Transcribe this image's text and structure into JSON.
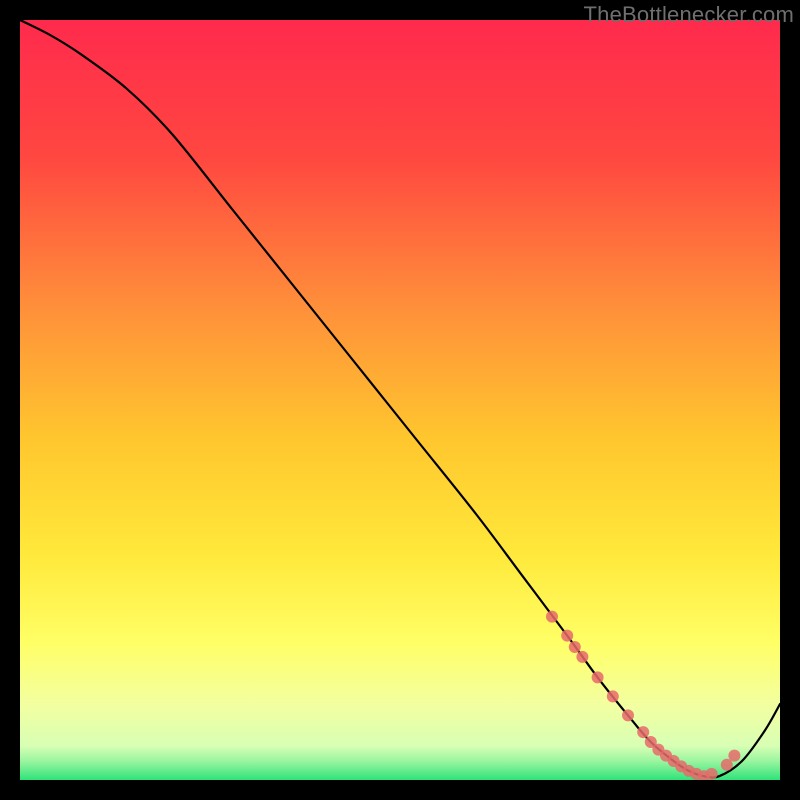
{
  "watermark": "TheBottlenecker.com",
  "colors": {
    "black": "#000000",
    "curve": "#000000",
    "marker": "#e66a6a",
    "gradient_top": "#ff2a4d",
    "gradient_mid_hi": "#ff7a3f",
    "gradient_mid": "#ffd21f",
    "gradient_mid_lo": "#ffff66",
    "gradient_low": "#f6ffb2",
    "gradient_bottom": "#2fe37a"
  },
  "chart_data": {
    "type": "line",
    "title": "",
    "xlabel": "",
    "ylabel": "",
    "xlim": [
      0,
      100
    ],
    "ylim": [
      0,
      100
    ],
    "grid": false,
    "legend": false,
    "series": [
      {
        "name": "bottleneck-curve",
        "x": [
          0,
          4,
          8,
          14,
          20,
          28,
          36,
          44,
          52,
          60,
          66,
          72,
          76,
          80,
          83,
          86,
          88,
          90,
          92,
          95,
          98,
          100
        ],
        "y": [
          100,
          98,
          95.5,
          91,
          85,
          75,
          65,
          55,
          45,
          35,
          27,
          19,
          13.5,
          8.5,
          5,
          2.5,
          1.2,
          0.5,
          0.5,
          2.5,
          6.5,
          10
        ]
      }
    ],
    "markers": [
      {
        "name": "highlighted-points",
        "x": [
          70,
          72,
          73,
          74,
          76,
          78,
          80,
          82,
          83,
          84,
          85,
          86,
          87,
          88,
          89,
          90,
          91,
          93,
          94
        ],
        "y": [
          21.5,
          19,
          17.5,
          16.2,
          13.5,
          11,
          8.5,
          6.3,
          5,
          4,
          3.2,
          2.5,
          1.8,
          1.2,
          0.8,
          0.5,
          0.8,
          2,
          3.2
        ]
      }
    ],
    "background": {
      "type": "vertical-gradient",
      "stops": [
        {
          "offset": 0.0,
          "color": "#ff2a4d"
        },
        {
          "offset": 0.18,
          "color": "#ff4740"
        },
        {
          "offset": 0.38,
          "color": "#ff903a"
        },
        {
          "offset": 0.55,
          "color": "#ffc62e"
        },
        {
          "offset": 0.7,
          "color": "#ffe83a"
        },
        {
          "offset": 0.82,
          "color": "#ffff66"
        },
        {
          "offset": 0.9,
          "color": "#f3ffa0"
        },
        {
          "offset": 0.955,
          "color": "#d8ffb4"
        },
        {
          "offset": 0.975,
          "color": "#9bf5a0"
        },
        {
          "offset": 1.0,
          "color": "#2fe37a"
        }
      ]
    }
  }
}
